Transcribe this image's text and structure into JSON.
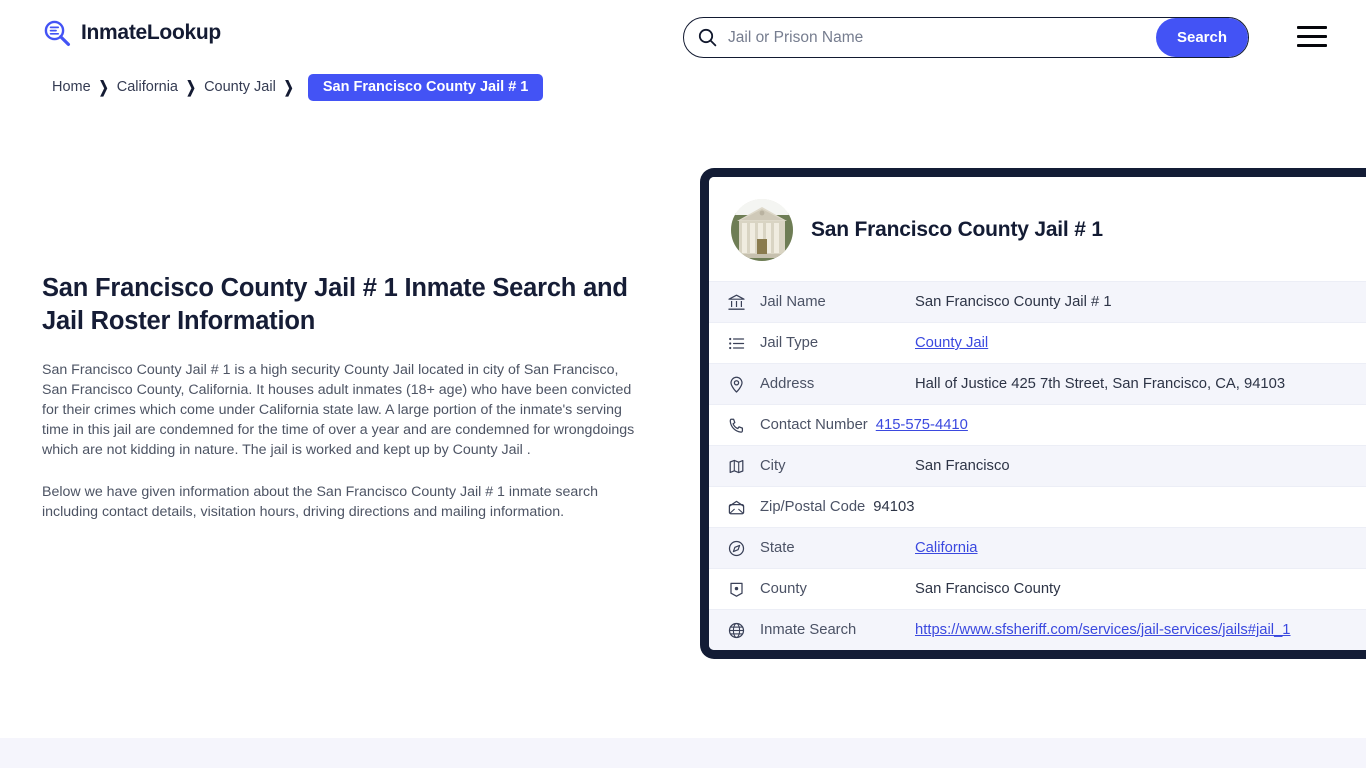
{
  "header": {
    "brand_name": "InmateLookup",
    "brand_icon": "magnifier-logo-icon",
    "menu_icon": "hamburger-menu-icon"
  },
  "search": {
    "icon": "search-icon",
    "placeholder": "Jail or Prison Name",
    "value": "",
    "button_label": "Search"
  },
  "breadcrumb": {
    "items": [
      {
        "label": "Home"
      },
      {
        "label": "California"
      },
      {
        "label": "County Jail"
      }
    ],
    "separator": "❯",
    "current": "San Francisco County Jail # 1"
  },
  "main": {
    "title": "San Francisco County Jail # 1 Inmate Search and Jail Roster Information",
    "paragraph_1": "San Francisco County Jail # 1 is a high security County Jail located in city of San Francisco, San Francisco County, California. It houses adult inmates (18+ age) who have been convicted for their crimes which come under California state law. A large portion of the inmate's serving time in this jail are condemned for the time of over a year and are condemned for wrongdoings which are not kidding in nature. The jail is worked and kept up by County Jail .",
    "paragraph_2": "Below we have given information about the San Francisco County Jail # 1 inmate search including contact details, visitation hours, driving directions and mailing information."
  },
  "card": {
    "thumbnail_icon": "courthouse-building-photo",
    "title": "San Francisco County Jail # 1",
    "rows": [
      {
        "icon": "bank-icon",
        "label": "Jail Name",
        "value": "San Francisco County Jail # 1",
        "link": false
      },
      {
        "icon": "list-icon",
        "label": "Jail Type",
        "value": "County Jail",
        "link": true
      },
      {
        "icon": "map-pin-icon",
        "label": "Address",
        "value": "Hall of Justice 425 7th Street, San Francisco, CA, 94103",
        "link": false
      },
      {
        "icon": "phone-icon",
        "label": "Contact Number",
        "value": "415-575-4410",
        "link": true
      },
      {
        "icon": "map-icon",
        "label": "City",
        "value": "San Francisco",
        "link": false
      },
      {
        "icon": "envelope-icon",
        "label": "Zip/Postal Code",
        "value": "94103",
        "link": false
      },
      {
        "icon": "compass-icon",
        "label": "State",
        "value": "California",
        "link": true
      },
      {
        "icon": "county-badge-icon",
        "label": "County",
        "value": "San Francisco County",
        "link": false
      },
      {
        "icon": "globe-icon",
        "label": "Inmate Search",
        "value": "https://www.sfsheriff.com/services/jail-services/jails#jail_1",
        "link": true
      }
    ]
  },
  "colors": {
    "accent_blue": "#4353f5",
    "link_blue": "#3b49df",
    "dark_navy": "#131c35",
    "row_alt": "#f4f5fb",
    "footer_band": "#f5f5fc"
  }
}
